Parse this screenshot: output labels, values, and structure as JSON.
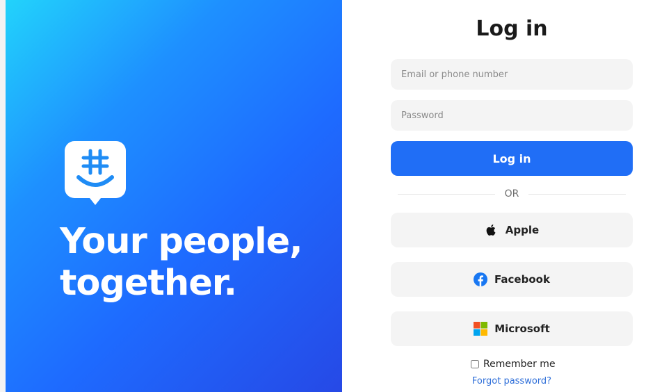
{
  "hero": {
    "tagline_line1": "Your people,",
    "tagline_line2": "together."
  },
  "login": {
    "title": "Log in",
    "email_placeholder": "Email or phone number",
    "password_placeholder": "Password",
    "submit_label": "Log in",
    "divider_label": "OR",
    "social": {
      "apple_label": "Apple",
      "facebook_label": "Facebook",
      "microsoft_label": "Microsoft"
    },
    "remember_label": "Remember me",
    "remember_checked": false,
    "forgot_label": "Forgot password?"
  },
  "icons": {
    "logo": "groupme-chat-hash-icon",
    "apple": "apple-icon",
    "facebook": "facebook-icon",
    "microsoft": "microsoft-icon"
  },
  "colors": {
    "primary_button": "#206ef6",
    "hero_gradient_start": "#22d3fb",
    "hero_gradient_end": "#2649e6",
    "link": "#2f6fd9",
    "facebook_blue": "#1877f2"
  }
}
